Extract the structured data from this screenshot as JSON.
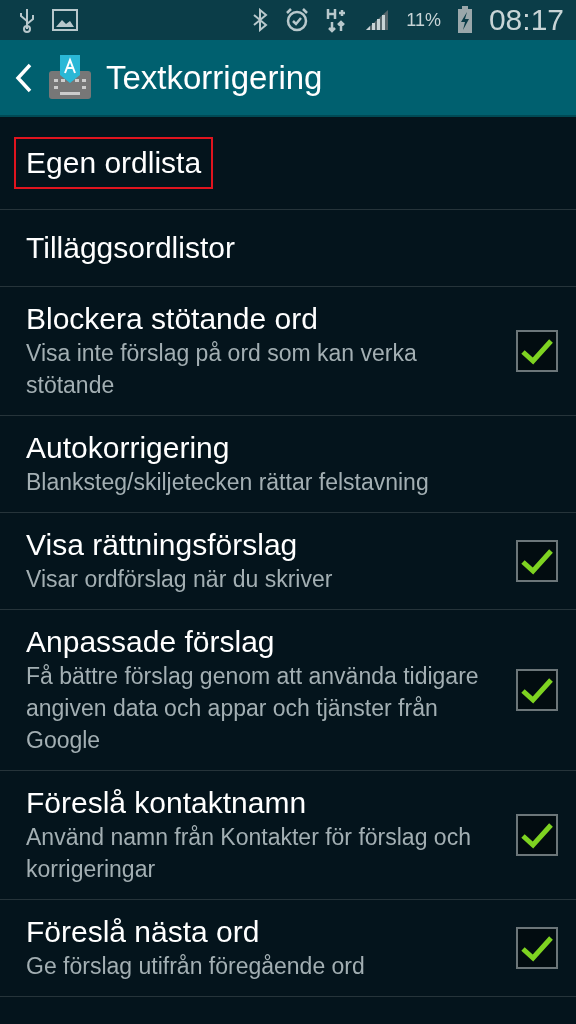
{
  "status_bar": {
    "battery": "11%",
    "time": "08:17"
  },
  "header": {
    "title": "Textkorrigering"
  },
  "items": [
    {
      "kind": "link",
      "title": "Egen ordlista",
      "highlighted": true
    },
    {
      "kind": "link",
      "title": "Tilläggsordlistor",
      "highlighted": false
    },
    {
      "kind": "checkbox",
      "title": "Blockera stötande ord",
      "subtitle": "Visa inte förslag på ord som kan verka stötande",
      "checked": true
    },
    {
      "kind": "detail",
      "title": "Autokorrigering",
      "subtitle": "Blanksteg/skiljetecken rättar felstavning"
    },
    {
      "kind": "checkbox",
      "title": "Visa rättningsförslag",
      "subtitle": "Visar ordförslag när du skriver",
      "checked": true
    },
    {
      "kind": "checkbox",
      "title": "Anpassade förslag",
      "subtitle": "Få bättre förslag genom att använda tidigare angiven data och appar och tjänster från Google",
      "checked": true
    },
    {
      "kind": "checkbox",
      "title": "Föreslå kontaktnamn",
      "subtitle": "Använd namn från Kontakter för förslag och korrigeringar",
      "checked": true
    },
    {
      "kind": "checkbox",
      "title": "Föreslå nästa ord",
      "subtitle": "Ge förslag utifrån föregående ord",
      "checked": true
    }
  ]
}
